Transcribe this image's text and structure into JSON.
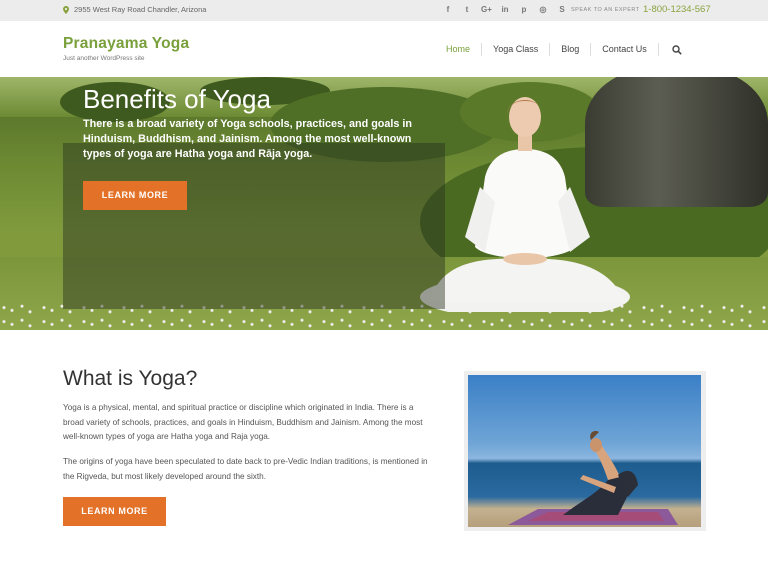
{
  "topbar": {
    "address": "2955 West Ray Road Chandler, Arizona",
    "social_icons": [
      "facebook-icon",
      "twitter-icon",
      "google-plus-icon",
      "linkedin-icon",
      "pinterest-icon",
      "instagram-icon",
      "skype-icon"
    ],
    "social_glyphs": [
      "f",
      "t",
      "G+",
      "in",
      "p",
      "◎",
      "S"
    ],
    "speak_label": "SPEAK TO AN EXPERT",
    "phone": "1-800-1234-567"
  },
  "header": {
    "logo": "Pranayama Yoga",
    "tagline": "Just another WordPress site",
    "nav": [
      "Home",
      "Yoga Class",
      "Blog",
      "Contact Us"
    ],
    "active_nav": "Home"
  },
  "hero": {
    "title": "Benefits of Yoga",
    "text": "There is a broad variety of Yoga schools, practices, and goals in Hinduism, Buddhism, and Jainism. Among the most well-known types of yoga are Hatha yoga and Rāja yoga.",
    "button": "LEARN MORE"
  },
  "about": {
    "title": "What is Yoga?",
    "paragraph1": "Yoga is a physical, mental, and spiritual practice or discipline which originated in India. There is a broad variety of schools, practices, and goals in Hinduism, Buddhism and Jainism. Among the most well-known types of yoga are Hatha yoga and Raja yoga.",
    "paragraph2": "The origins of yoga have been speculated to date back to pre-Vedic Indian traditions, is mentioned in the Rigveda, but most likely developed around the sixth.",
    "button": "LEARN MORE"
  },
  "colors": {
    "brand_green": "#79a03c",
    "accent_orange": "#e37228",
    "topbar_bg": "#ececec"
  }
}
